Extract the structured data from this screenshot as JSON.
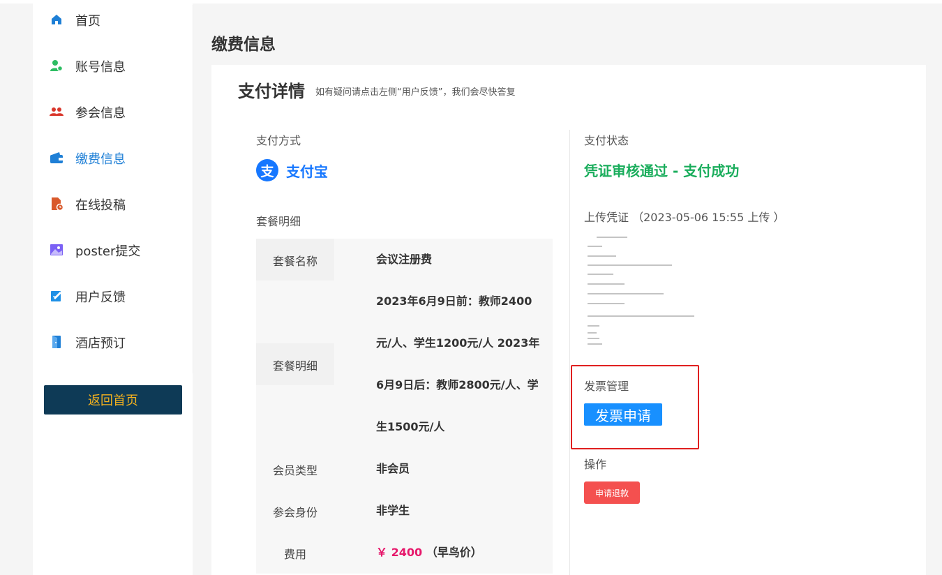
{
  "sidebar": {
    "items": [
      {
        "label": "首页",
        "icon": "home-icon",
        "color": "#1e7fd6"
      },
      {
        "label": "账号信息",
        "icon": "user-settings-icon",
        "color": "#2dbd62"
      },
      {
        "label": "参会信息",
        "icon": "users-icon",
        "color": "#d9362b"
      },
      {
        "label": "缴费信息",
        "icon": "wallet-icon",
        "color": "#1e7fd6",
        "active": true
      },
      {
        "label": "在线投稿",
        "icon": "document-clock-icon",
        "color": "#d9592b"
      },
      {
        "label": "poster提交",
        "icon": "image-icon",
        "color": "#7b61f5"
      },
      {
        "label": "用户反馈",
        "icon": "edit-note-icon",
        "color": "#1e90e6"
      },
      {
        "label": "酒店预订",
        "icon": "door-icon",
        "color": "#1e7fd6"
      }
    ],
    "back_button": "返回首页"
  },
  "page_title": "缴费信息",
  "card": {
    "title": "支付详情",
    "hint": "如有疑问请点击左侧“用户反馈”，我们会尽快答复",
    "payment_method_label": "支付方式",
    "payment_method": "支付宝",
    "alipay_logo_char": "支",
    "package_label": "套餐明细",
    "table": {
      "name_key": "套餐名称",
      "name_value": "会议注册费",
      "detail_key": "套餐明细",
      "detail_value": "2023年6月9日前：教师2400元/人、学生1200元/人 2023年6月9日后：教师2800元/人、学生1500元/人",
      "member_key": "会员类型",
      "member_value": "非会员",
      "identity_key": "参会身份",
      "identity_value": "非学生",
      "fee_key": "费用",
      "fee_amount": "￥ 2400",
      "fee_note": "（早鸟价）"
    },
    "status_label": "支付状态",
    "status_text": "凭证审核通过 - 支付成功",
    "upload_label": "上传凭证 （2023-05-06 15:55 上传 ）",
    "invoice_label": "发票管理",
    "invoice_button": "发票申请",
    "operation_label": "操作",
    "refund_button": "申请退款"
  },
  "colors": {
    "accent": "#1e7fd6",
    "success": "#1aad5c",
    "danger": "#f4504f",
    "price": "#e6186b",
    "back_bg": "#0e3a56",
    "back_text": "#f5b21e"
  }
}
